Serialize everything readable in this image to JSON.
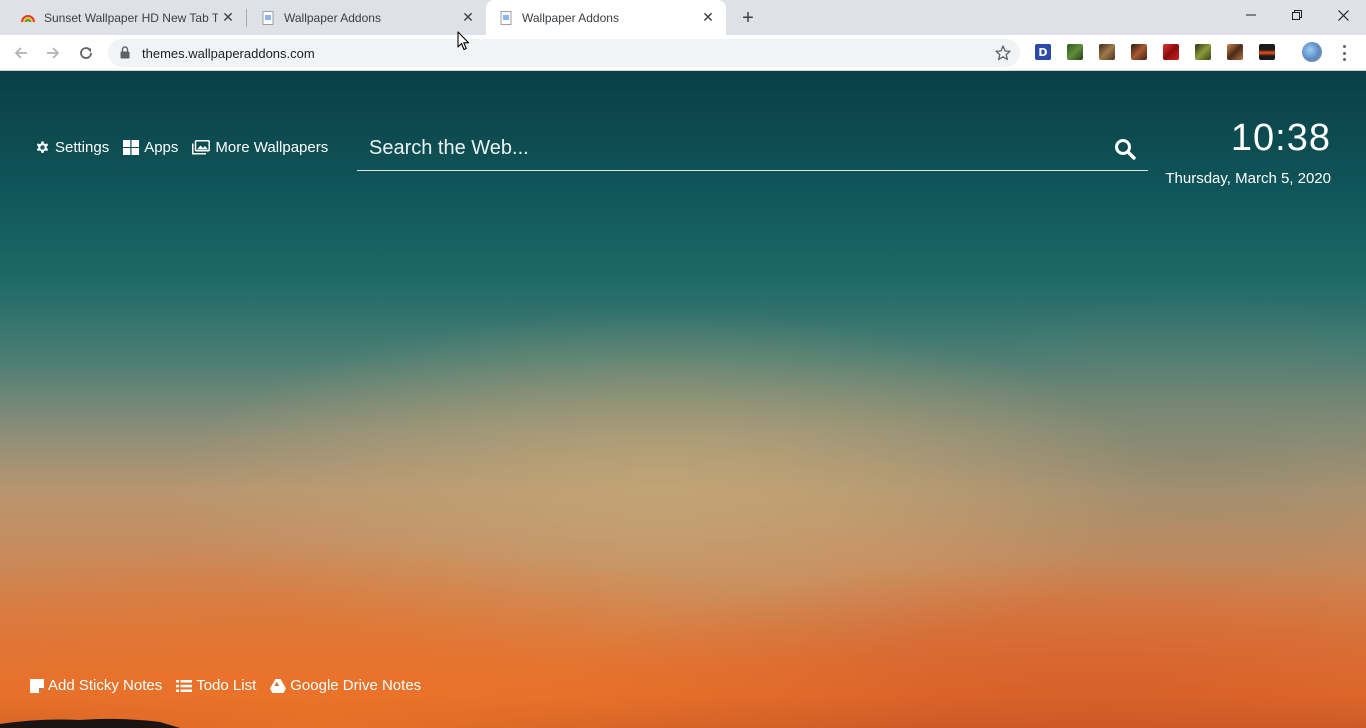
{
  "browser": {
    "tabs": [
      {
        "title": "Sunset Wallpaper HD New Tab Theme",
        "active": false
      },
      {
        "title": "Wallpaper Addons",
        "active": false
      },
      {
        "title": "Wallpaper Addons",
        "active": true
      }
    ],
    "new_tab_symbol": "+",
    "window_controls": {
      "minimize": "—",
      "maximize": "❐",
      "close": "✕"
    },
    "url": "themes.wallpaperaddons.com",
    "extensions": [
      {
        "name": "d-extension-icon",
        "label": "D",
        "color": "#2a4aa8"
      },
      {
        "name": "wallpaper-ext-1-icon",
        "color": "#3c6b2e"
      },
      {
        "name": "wallpaper-ext-2-icon",
        "color": "#6b4a2e"
      },
      {
        "name": "wallpaper-ext-3-icon",
        "color": "#7a3a22"
      },
      {
        "name": "wallpaper-ext-4-icon",
        "color": "#c02222"
      },
      {
        "name": "wallpaper-ext-5-icon",
        "color": "#5a6a22"
      },
      {
        "name": "wallpaper-ext-6-icon",
        "color": "#8a5a30"
      },
      {
        "name": "wallpaper-ext-7-icon",
        "color": "#d84a10"
      }
    ]
  },
  "page": {
    "nav": {
      "settings": "Settings",
      "apps": "Apps",
      "more_wallpapers": "More Wallpapers"
    },
    "search": {
      "placeholder": "Search the Web..."
    },
    "clock": {
      "time": "10:38",
      "date": "Thursday, March 5, 2020"
    },
    "bottom": {
      "sticky_notes": "Add Sticky Notes",
      "todo": "Todo List",
      "drive_notes": "Google Drive Notes"
    }
  }
}
